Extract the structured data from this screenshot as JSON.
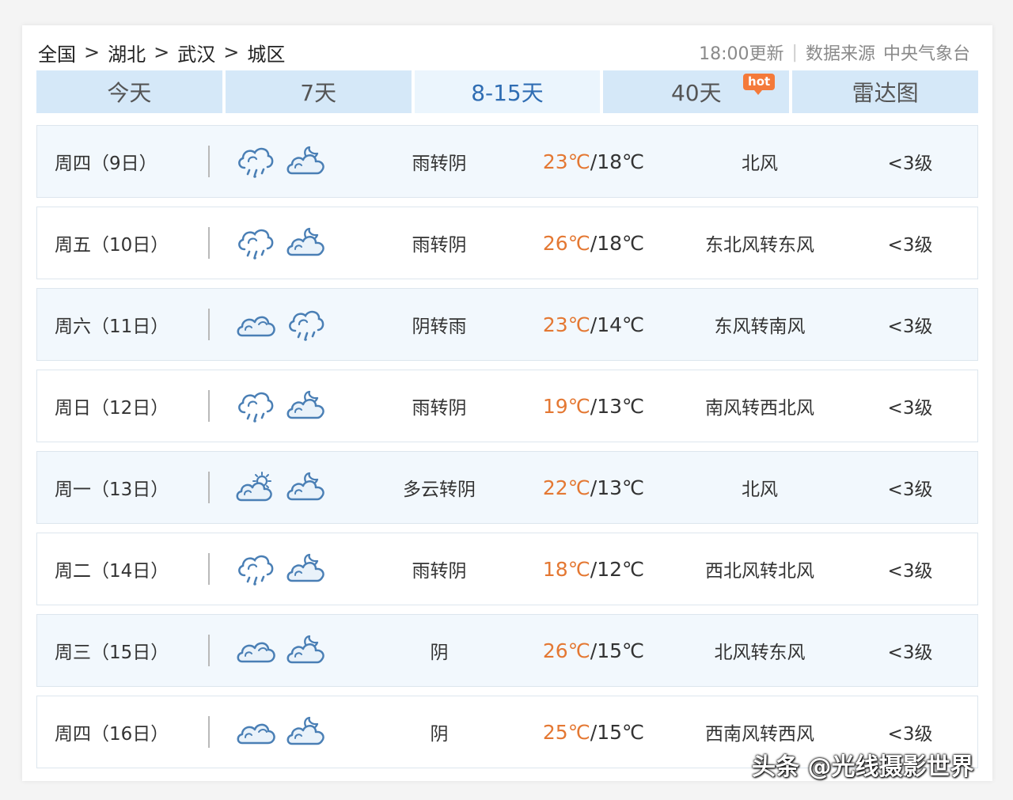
{
  "breadcrumb": [
    "全国",
    "湖北",
    "武汉",
    "城区"
  ],
  "breadcrumb_sep": ">",
  "meta": {
    "updated": "18:00更新",
    "source_label": "数据来源",
    "source": "中央气象台"
  },
  "tabs": [
    {
      "label": "今天"
    },
    {
      "label": "7天"
    },
    {
      "label": "8-15天",
      "active": true
    },
    {
      "label": "40天",
      "badge": "hot"
    },
    {
      "label": "雷达图"
    }
  ],
  "forecast": [
    {
      "day": "周四（9日）",
      "icons": [
        "rain-cloud-icon",
        "night-cloudy-icon"
      ],
      "weather": "雨转阴",
      "high": "23℃",
      "low": "18℃",
      "wind": "北风",
      "level": "<3级"
    },
    {
      "day": "周五（10日）",
      "icons": [
        "rain-cloud-icon",
        "night-cloudy-icon"
      ],
      "weather": "雨转阴",
      "high": "26℃",
      "low": "18℃",
      "wind": "东北风转东风",
      "level": "<3级"
    },
    {
      "day": "周六（11日）",
      "icons": [
        "overcast-icon",
        "rain-cloud-icon"
      ],
      "weather": "阴转雨",
      "high": "23℃",
      "low": "14℃",
      "wind": "东风转南风",
      "level": "<3级"
    },
    {
      "day": "周日（12日）",
      "icons": [
        "rain-cloud-icon",
        "night-cloudy-icon"
      ],
      "weather": "雨转阴",
      "high": "19℃",
      "low": "13℃",
      "wind": "南风转西北风",
      "level": "<3级"
    },
    {
      "day": "周一（13日）",
      "icons": [
        "partly-cloudy-icon",
        "night-cloudy-icon"
      ],
      "weather": "多云转阴",
      "high": "22℃",
      "low": "13℃",
      "wind": "北风",
      "level": "<3级"
    },
    {
      "day": "周二（14日）",
      "icons": [
        "rain-cloud-icon",
        "night-cloudy-icon"
      ],
      "weather": "雨转阴",
      "high": "18℃",
      "low": "12℃",
      "wind": "西北风转北风",
      "level": "<3级"
    },
    {
      "day": "周三（15日）",
      "icons": [
        "overcast-icon",
        "night-cloudy-icon"
      ],
      "weather": "阴",
      "high": "26℃",
      "low": "15℃",
      "wind": "北风转东风",
      "level": "<3级"
    },
    {
      "day": "周四（16日）",
      "icons": [
        "overcast-icon",
        "night-cloudy-icon"
      ],
      "weather": "阴",
      "high": "25℃",
      "low": "15℃",
      "wind": "西南风转西风",
      "level": "<3级"
    }
  ],
  "colors": {
    "tab_bg": "#d5e8f8",
    "tab_active_text": "#2f6db3",
    "high_temp": "#e47833",
    "icon_stroke": "#4a7fb5",
    "hot_badge": "#f47a3a"
  },
  "watermark": "头条 @光线摄影世界"
}
